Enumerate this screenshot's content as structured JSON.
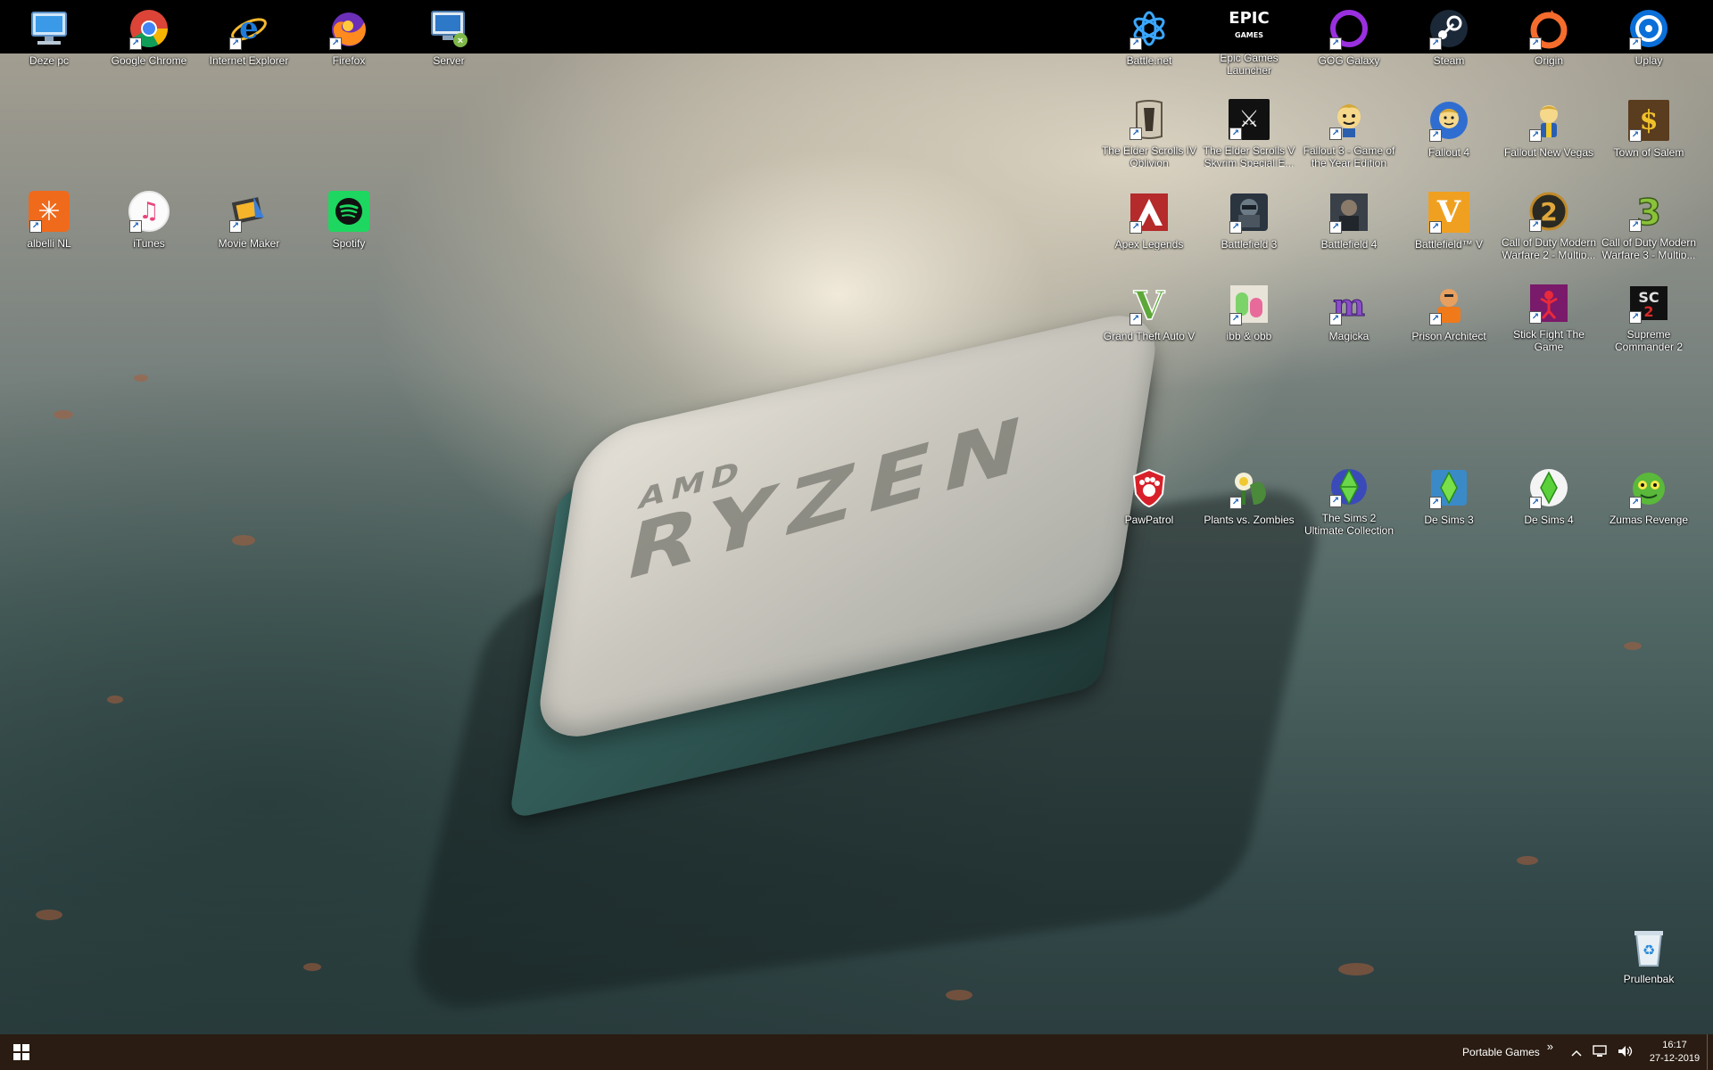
{
  "left_icons": [
    {
      "id": "deze-pc",
      "label": "Deze pc",
      "icon": "computer-icon",
      "shortcut": false
    },
    {
      "id": "chrome",
      "label": "Google Chrome",
      "icon": "chrome-icon",
      "shortcut": true
    },
    {
      "id": "ie",
      "label": "Internet Explorer",
      "icon": "internet-explorer-icon",
      "shortcut": true
    },
    {
      "id": "firefox",
      "label": "Firefox",
      "icon": "firefox-icon",
      "shortcut": true
    },
    {
      "id": "server",
      "label": "Server",
      "icon": "network-drive-icon",
      "shortcut": false
    },
    {
      "id": "albelli",
      "label": "albelli NL",
      "icon": "albelli-icon",
      "shortcut": true
    },
    {
      "id": "itunes",
      "label": "iTunes",
      "icon": "itunes-icon",
      "shortcut": true
    },
    {
      "id": "movie-maker",
      "label": "Movie Maker",
      "icon": "movie-maker-icon",
      "shortcut": true
    },
    {
      "id": "spotify",
      "label": "Spotify",
      "icon": "spotify-icon",
      "shortcut": false
    }
  ],
  "right_icons": [
    {
      "id": "battlenet",
      "label": "Battle.net",
      "icon": "battlenet-icon",
      "shortcut": true
    },
    {
      "id": "epic",
      "label": "Epic Games Launcher",
      "icon": "epic-games-icon",
      "shortcut": false
    },
    {
      "id": "gog",
      "label": "GOG Galaxy",
      "icon": "gog-galaxy-icon",
      "shortcut": true
    },
    {
      "id": "steam",
      "label": "Steam",
      "icon": "steam-icon",
      "shortcut": true
    },
    {
      "id": "origin",
      "label": "Origin",
      "icon": "origin-icon",
      "shortcut": true
    },
    {
      "id": "uplay",
      "label": "Uplay",
      "icon": "uplay-icon",
      "shortcut": true
    },
    {
      "id": "oblivion",
      "label": "The Elder Scrolls IV Oblivion",
      "icon": "oblivion-icon",
      "shortcut": true
    },
    {
      "id": "skyrim",
      "label": "The Elder Scrolls V Skyrim Special E...",
      "icon": "skyrim-icon",
      "shortcut": true
    },
    {
      "id": "fallout3",
      "label": "Fallout 3 - Game of the Year Edition",
      "icon": "fallout3-icon",
      "shortcut": true
    },
    {
      "id": "fallout4",
      "label": "Fallout 4",
      "icon": "fallout4-icon",
      "shortcut": true
    },
    {
      "id": "falloutnv",
      "label": "Fallout New Vegas",
      "icon": "fallout-new-vegas-icon",
      "shortcut": true
    },
    {
      "id": "salem",
      "label": "Town of Salem",
      "icon": "town-of-salem-icon",
      "shortcut": true
    },
    {
      "id": "apex",
      "label": "Apex Legends",
      "icon": "apex-legends-icon",
      "shortcut": true
    },
    {
      "id": "bf3",
      "label": "Battlefield 3",
      "icon": "battlefield3-icon",
      "shortcut": true
    },
    {
      "id": "bf4",
      "label": "Battlefield 4",
      "icon": "battlefield4-icon",
      "shortcut": true
    },
    {
      "id": "bfv",
      "label": "Battlefield™ V",
      "icon": "battlefield5-icon",
      "shortcut": true
    },
    {
      "id": "mw2",
      "label": "Call of Duty Modern Warfare 2 - Multip...",
      "icon": "mw2-icon",
      "shortcut": true
    },
    {
      "id": "mw3",
      "label": "Call of Duty Modern Warfare 3 - Multip...",
      "icon": "mw3-icon",
      "shortcut": true
    },
    {
      "id": "gta5",
      "label": "Grand Theft Auto V",
      "icon": "gta5-icon",
      "shortcut": true
    },
    {
      "id": "ibb",
      "label": "ibb & obb",
      "icon": "ibb-obb-icon",
      "shortcut": true
    },
    {
      "id": "magicka",
      "label": "Magicka",
      "icon": "magicka-icon",
      "shortcut": true
    },
    {
      "id": "prison",
      "label": "Prison Architect",
      "icon": "prison-architect-icon",
      "shortcut": true
    },
    {
      "id": "stickfight",
      "label": "Stick Fight The Game",
      "icon": "stick-fight-icon",
      "shortcut": true
    },
    {
      "id": "sc2",
      "label": "Supreme Commander 2",
      "icon": "supreme-commander-icon",
      "shortcut": true
    },
    {
      "id": "pawpatrol",
      "label": "PawPatrol",
      "icon": "paw-patrol-icon",
      "shortcut": false
    },
    {
      "id": "pvz",
      "label": "Plants vs. Zombies",
      "icon": "plants-vs-zombies-icon",
      "shortcut": true
    },
    {
      "id": "sims2",
      "label": "The Sims 2 Ultimate Collection",
      "icon": "sims2-icon",
      "shortcut": true
    },
    {
      "id": "sims3",
      "label": "De Sims 3",
      "icon": "sims3-icon",
      "shortcut": true
    },
    {
      "id": "sims4",
      "label": "De Sims 4",
      "icon": "sims4-icon",
      "shortcut": true
    },
    {
      "id": "zuma",
      "label": "Zumas Revenge",
      "icon": "zumas-revenge-icon",
      "shortcut": true
    },
    {
      "id": "bin",
      "label": "Prullenbak",
      "icon": "recycle-bin-icon",
      "shortcut": false
    }
  ],
  "wallpaper": {
    "brand_small": "AMD",
    "brand_large": "RYZEN"
  },
  "taskbar": {
    "toolbar_label": "Portable Games",
    "toolbar_chevron": "»",
    "time": "16:17",
    "date": "27-12-2019"
  },
  "colors": {
    "taskbar": "#2a1c12",
    "label_text": "#ffffff",
    "top_band": "#000000"
  }
}
